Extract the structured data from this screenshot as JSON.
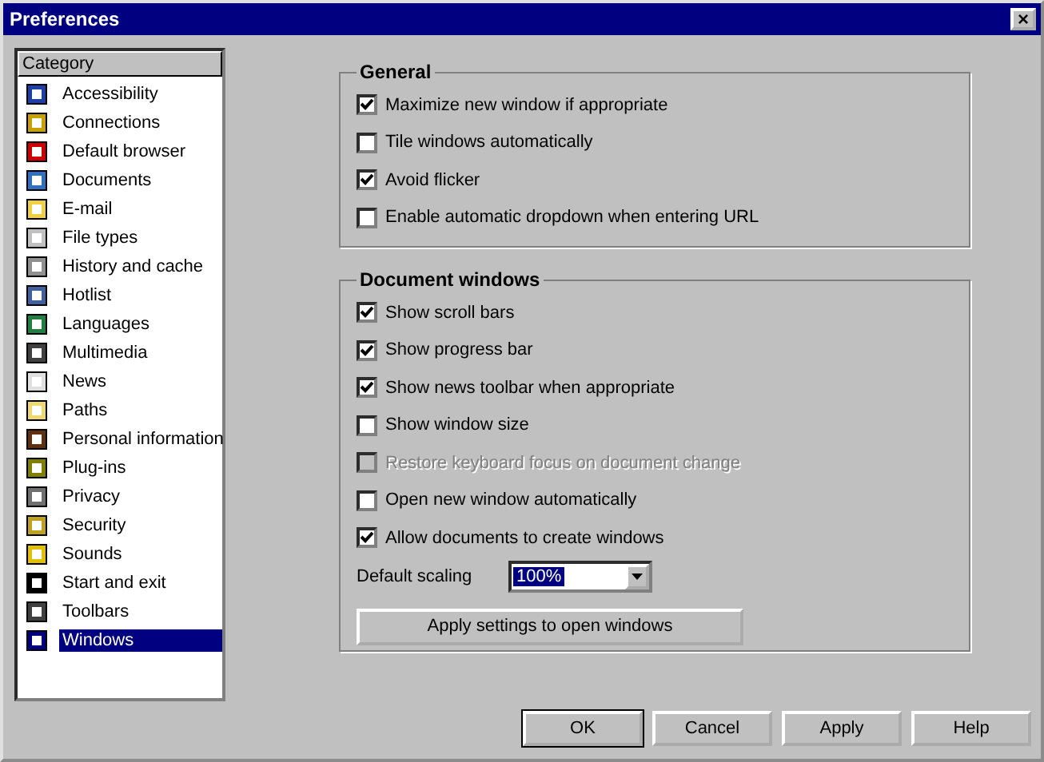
{
  "window": {
    "title": "Preferences",
    "close": "×"
  },
  "sidebar": {
    "header": "Category",
    "items": [
      {
        "label": "Accessibility",
        "selected": false
      },
      {
        "label": "Connections",
        "selected": false
      },
      {
        "label": "Default browser",
        "selected": false
      },
      {
        "label": "Documents",
        "selected": false
      },
      {
        "label": "E-mail",
        "selected": false
      },
      {
        "label": "File types",
        "selected": false
      },
      {
        "label": "History and cache",
        "selected": false
      },
      {
        "label": "Hotlist",
        "selected": false
      },
      {
        "label": "Languages",
        "selected": false
      },
      {
        "label": "Multimedia",
        "selected": false
      },
      {
        "label": "News",
        "selected": false
      },
      {
        "label": "Paths",
        "selected": false
      },
      {
        "label": "Personal information",
        "selected": false
      },
      {
        "label": "Plug-ins",
        "selected": false
      },
      {
        "label": "Privacy",
        "selected": false
      },
      {
        "label": "Security",
        "selected": false
      },
      {
        "label": "Sounds",
        "selected": false
      },
      {
        "label": "Start and exit",
        "selected": false
      },
      {
        "label": "Toolbars",
        "selected": false
      },
      {
        "label": "Windows",
        "selected": true
      }
    ]
  },
  "general": {
    "title": "General",
    "options": [
      {
        "label": "Maximize new window if appropriate",
        "checked": true,
        "disabled": false
      },
      {
        "label": "Tile windows automatically",
        "checked": false,
        "disabled": false
      },
      {
        "label": "Avoid flicker",
        "checked": true,
        "disabled": false
      },
      {
        "label": "Enable automatic dropdown when entering URL",
        "checked": false,
        "disabled": false
      }
    ]
  },
  "document_windows": {
    "title": "Document windows",
    "options": [
      {
        "label": "Show scroll bars",
        "checked": true,
        "disabled": false
      },
      {
        "label": "Show progress bar",
        "checked": true,
        "disabled": false
      },
      {
        "label": "Show news toolbar when appropriate",
        "checked": true,
        "disabled": false
      },
      {
        "label": "Show window size",
        "checked": false,
        "disabled": false
      },
      {
        "label": "Restore keyboard focus on document change",
        "checked": false,
        "disabled": true
      },
      {
        "label": "Open new window automatically",
        "checked": false,
        "disabled": false
      },
      {
        "label": "Allow documents to create windows",
        "checked": true,
        "disabled": false
      }
    ],
    "scaling_label": "Default scaling",
    "scaling_value": "100%",
    "apply_button": "Apply settings to open windows"
  },
  "buttons": [
    "OK",
    "Cancel",
    "Apply",
    "Help"
  ]
}
